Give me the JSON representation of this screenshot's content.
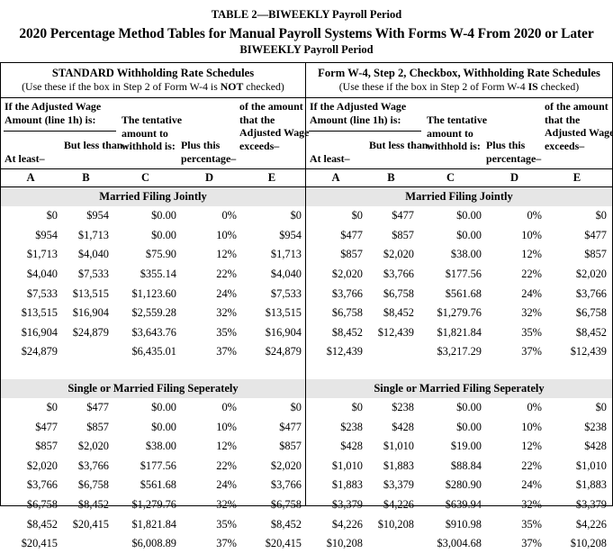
{
  "document": {
    "title_line1": "TABLE 2—BIWEEKLY Payroll Period",
    "title_line2": "2020 Percentage Method Tables for Manual Payroll Systems With Forms W-4 From 2020 or Later",
    "title_line3": "BIWEEKLY Payroll Period"
  },
  "column_header": {
    "adjusted_wage_label": "If the Adjusted Wage Amount (line 1h) is:",
    "at_least": "At least–",
    "but_less_than": "But less than–",
    "tentative": "The tentative amount to withhold is:",
    "plus_percentage": "Plus this percentage–",
    "of_the_amount": "of the amount that the Adjusted Wage exceeds–",
    "letters": [
      "A",
      "B",
      "C",
      "D",
      "E"
    ]
  },
  "schedules": [
    {
      "id": "standard",
      "heading": "STANDARD Withholding Rate Schedules",
      "note_prefix": "(Use these if the box in Step 2 of Form W-4 is ",
      "note_emphasis": "NOT",
      "note_suffix": " checked)",
      "sections": [
        {
          "name": "Married Filing Jointly",
          "rows": [
            [
              "$0",
              "$954",
              "$0.00",
              "0%",
              "$0"
            ],
            [
              "$954",
              "$1,713",
              "$0.00",
              "10%",
              "$954"
            ],
            [
              "$1,713",
              "$4,040",
              "$75.90",
              "12%",
              "$1,713"
            ],
            [
              "$4,040",
              "$7,533",
              "$355.14",
              "22%",
              "$4,040"
            ],
            [
              "$7,533",
              "$13,515",
              "$1,123.60",
              "24%",
              "$7,533"
            ],
            [
              "$13,515",
              "$16,904",
              "$2,559.28",
              "32%",
              "$13,515"
            ],
            [
              "$16,904",
              "$24,879",
              "$3,643.76",
              "35%",
              "$16,904"
            ],
            [
              "$24,879",
              "",
              "$6,435.01",
              "37%",
              "$24,879"
            ]
          ]
        },
        {
          "name": "Single or Married Filing Seperately",
          "rows": [
            [
              "$0",
              "$477",
              "$0.00",
              "0%",
              "$0"
            ],
            [
              "$477",
              "$857",
              "$0.00",
              "10%",
              "$477"
            ],
            [
              "$857",
              "$2,020",
              "$38.00",
              "12%",
              "$857"
            ],
            [
              "$2,020",
              "$3,766",
              "$177.56",
              "22%",
              "$2,020"
            ],
            [
              "$3,766",
              "$6,758",
              "$561.68",
              "24%",
              "$3,766"
            ],
            [
              "$6,758",
              "$8,452",
              "$1,279.76",
              "32%",
              "$6,758"
            ],
            [
              "$8,452",
              "$20,415",
              "$1,821.84",
              "35%",
              "$8,452"
            ],
            [
              "$20,415",
              "",
              "$6,008.89",
              "37%",
              "$20,415"
            ]
          ]
        }
      ]
    },
    {
      "id": "checkbox",
      "heading": "Form W-4, Step 2, Checkbox, Withholding Rate Schedules",
      "note_prefix": "(Use these if the box in Step 2 of Form W-4 ",
      "note_emphasis": "IS",
      "note_suffix": " checked)",
      "sections": [
        {
          "name": "Married Filing Jointly",
          "rows": [
            [
              "$0",
              "$477",
              "$0.00",
              "0%",
              "$0"
            ],
            [
              "$477",
              "$857",
              "$0.00",
              "10%",
              "$477"
            ],
            [
              "$857",
              "$2,020",
              "$38.00",
              "12%",
              "$857"
            ],
            [
              "$2,020",
              "$3,766",
              "$177.56",
              "22%",
              "$2,020"
            ],
            [
              "$3,766",
              "$6,758",
              "$561.68",
              "24%",
              "$3,766"
            ],
            [
              "$6,758",
              "$8,452",
              "$1,279.76",
              "32%",
              "$6,758"
            ],
            [
              "$8,452",
              "$12,439",
              "$1,821.84",
              "35%",
              "$8,452"
            ],
            [
              "$12,439",
              "",
              "$3,217.29",
              "37%",
              "$12,439"
            ]
          ]
        },
        {
          "name": "Single or Married Filing Seperately",
          "rows": [
            [
              "$0",
              "$238",
              "$0.00",
              "0%",
              "$0"
            ],
            [
              "$238",
              "$428",
              "$0.00",
              "10%",
              "$238"
            ],
            [
              "$428",
              "$1,010",
              "$19.00",
              "12%",
              "$428"
            ],
            [
              "$1,010",
              "$1,883",
              "$88.84",
              "22%",
              "$1,010"
            ],
            [
              "$1,883",
              "$3,379",
              "$280.90",
              "24%",
              "$1,883"
            ],
            [
              "$3,379",
              "$4,226",
              "$639.94",
              "32%",
              "$3,379"
            ],
            [
              "$4,226",
              "$10,208",
              "$910.98",
              "35%",
              "$4,226"
            ],
            [
              "$10,208",
              "",
              "$3,004.68",
              "37%",
              "$10,208"
            ]
          ]
        }
      ]
    }
  ],
  "colors": {
    "section_banner_bg": "#e6e6e6",
    "rule": "#000000",
    "text": "#000000"
  }
}
